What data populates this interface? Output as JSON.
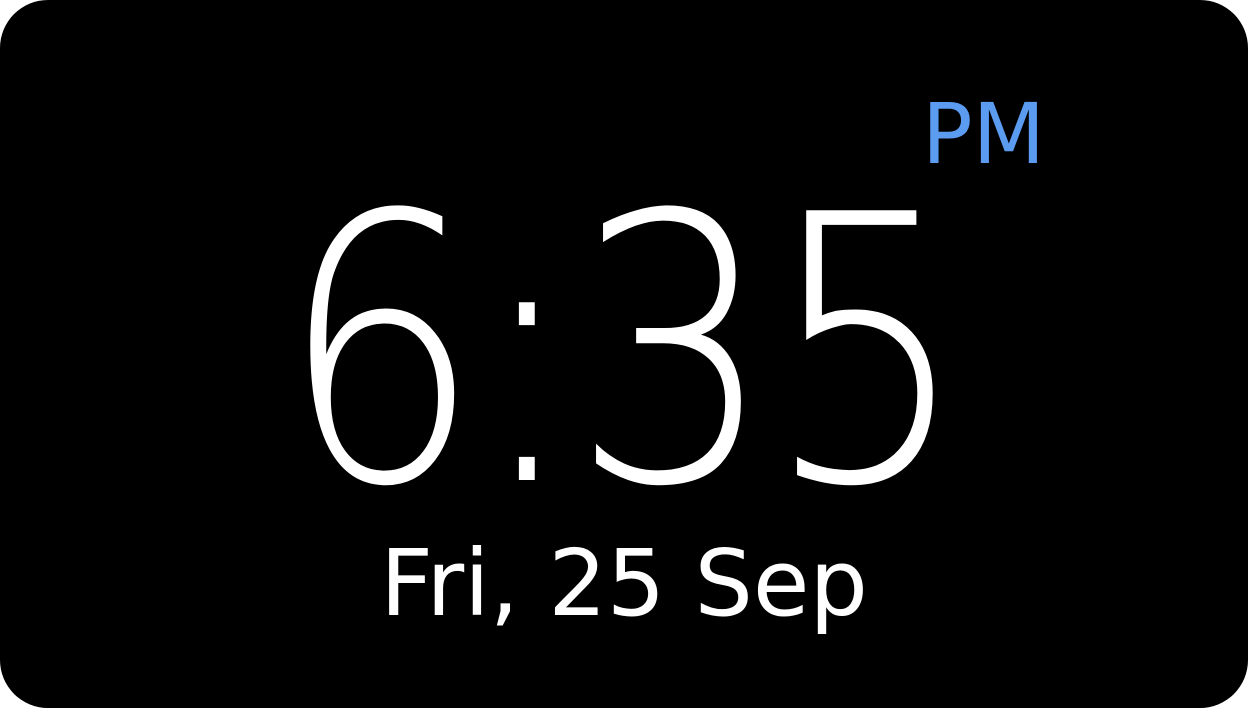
{
  "clock": {
    "time": "6:35",
    "ampm": "PM",
    "date": "Fri, 25 Sep"
  },
  "colors": {
    "background": "#000000",
    "time_text": "#ffffff",
    "ampm_accent": "#5b9cf0"
  }
}
